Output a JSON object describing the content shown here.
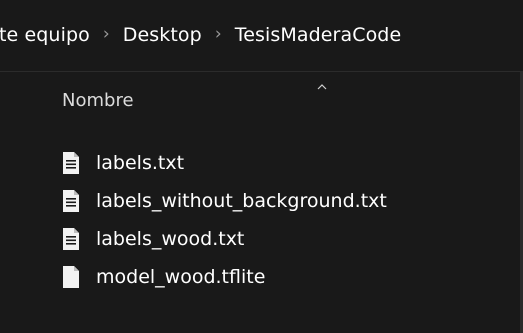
{
  "breadcrumb": {
    "items": [
      {
        "label": "ste equipo"
      },
      {
        "label": "Desktop"
      },
      {
        "label": "TesisMaderaCode"
      }
    ],
    "separator": "›"
  },
  "list": {
    "column_header": "Nombre",
    "sort_icon": "chevron-up-icon",
    "files": [
      {
        "name": "labels.txt",
        "icon": "text-file-icon"
      },
      {
        "name": "labels_without_background.txt",
        "icon": "text-file-icon"
      },
      {
        "name": "labels_wood.txt",
        "icon": "text-file-icon"
      },
      {
        "name": "model_wood.tflite",
        "icon": "blank-file-icon"
      }
    ]
  },
  "colors": {
    "background": "#191919",
    "text": "#ffffff",
    "icon": "#f2f2f2",
    "separator": "#9a9a9a"
  }
}
